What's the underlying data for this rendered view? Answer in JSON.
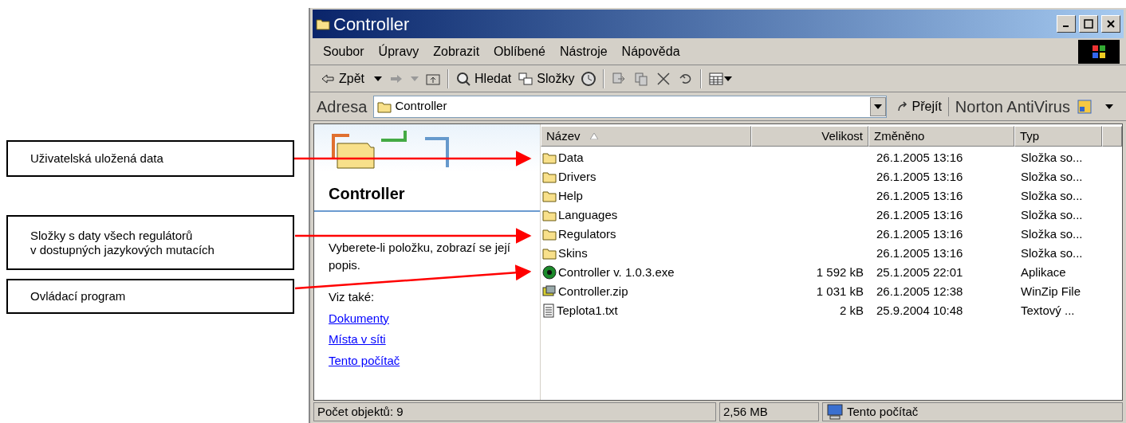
{
  "callouts": [
    {
      "text": "Uživatelská uložená data"
    },
    {
      "text": "Složky s daty všech regulátorů\nv dostupných jazykových mutacích"
    },
    {
      "text": "Ovládací program"
    }
  ],
  "window": {
    "title": "Controller"
  },
  "menu": [
    "Soubor",
    "Úpravy",
    "Zobrazit",
    "Oblíbené",
    "Nástroje",
    "Nápověda"
  ],
  "toolbar": [
    {
      "kind": "back",
      "label": "Zpět"
    },
    {
      "kind": "forward"
    },
    {
      "kind": "up"
    },
    {
      "kind": "sep"
    },
    {
      "kind": "search",
      "label": "Hledat"
    },
    {
      "kind": "folders",
      "label": "Složky"
    },
    {
      "kind": "history"
    },
    {
      "kind": "sep"
    },
    {
      "kind": "move"
    },
    {
      "kind": "copy"
    },
    {
      "kind": "delete"
    },
    {
      "kind": "undo"
    },
    {
      "kind": "sep"
    },
    {
      "kind": "views"
    }
  ],
  "address": {
    "label": "Adresa",
    "value": "Controller",
    "go": "Přejít",
    "norton": "Norton AntiVirus"
  },
  "task_pane": {
    "title": "Controller",
    "description": "Vyberete-li položku, zobrazí se její popis.",
    "see_also": "Viz také:",
    "links": [
      "Dokumenty",
      "Místa v síti",
      "Tento počítač"
    ]
  },
  "columns": [
    {
      "label": "Název",
      "sorted": true
    },
    {
      "label": "Velikost",
      "sorted": false
    },
    {
      "label": "Změněno",
      "sorted": false
    },
    {
      "label": "Typ",
      "sorted": false
    }
  ],
  "rows": [
    {
      "kind": "folder",
      "name": "Data",
      "size": "",
      "modified": "26.1.2005 13:16",
      "type": "Složka so..."
    },
    {
      "kind": "folder",
      "name": "Drivers",
      "modified": "26.1.2005 13:16",
      "type": "Složka so..."
    },
    {
      "kind": "folder",
      "name": "Help",
      "modified": "26.1.2005 13:16",
      "type": "Složka so..."
    },
    {
      "kind": "folder",
      "name": "Languages",
      "modified": "26.1.2005 13:16",
      "type": "Složka so..."
    },
    {
      "kind": "folder",
      "name": "Regulators",
      "modified": "26.1.2005 13:16",
      "type": "Složka so..."
    },
    {
      "kind": "folder",
      "name": "Skins",
      "modified": "26.1.2005 13:16",
      "type": "Složka so..."
    },
    {
      "kind": "exe",
      "name": "Controller v. 1.0.3.exe",
      "size": "1 592 kB",
      "modified": "25.1.2005 22:01",
      "type": "Aplikace"
    },
    {
      "kind": "zip",
      "name": "Controller.zip",
      "size": "1 031 kB",
      "modified": "26.1.2005 12:38",
      "type": "WinZip File"
    },
    {
      "kind": "txt",
      "name": "Teplota1.txt",
      "size": "2 kB",
      "modified": "25.9.2004 10:48",
      "type": "Textový ..."
    }
  ],
  "status_bar": [
    "Počet objektů: 9",
    "2,56 MB",
    "Tento počítač"
  ]
}
